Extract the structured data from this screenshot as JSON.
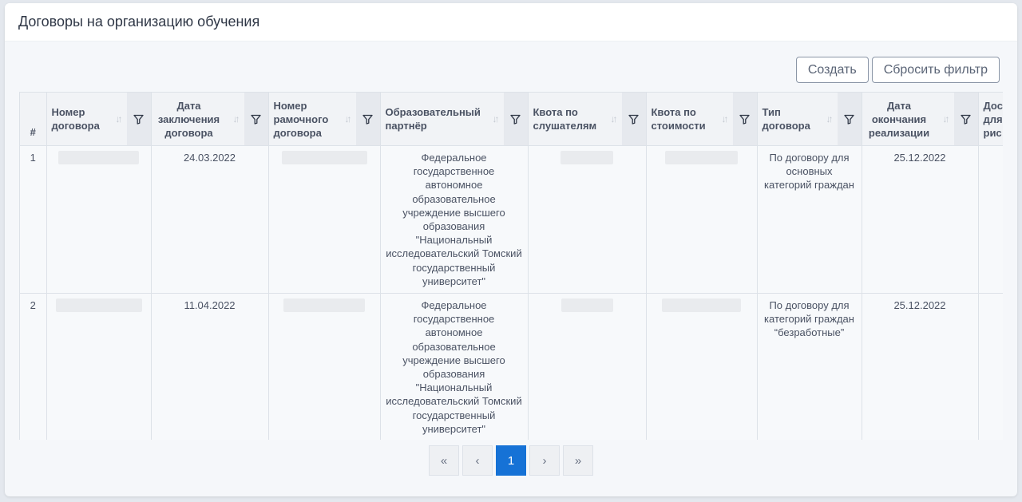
{
  "panel": {
    "title": "Договоры на организацию обучения"
  },
  "toolbar": {
    "create_label": "Создать",
    "reset_filter_label": "Сбросить фильтр"
  },
  "table": {
    "columns": [
      {
        "label": "#"
      },
      {
        "label": "Номер договора"
      },
      {
        "label": "Дата заключения договора"
      },
      {
        "label": "Номер рамочного договора"
      },
      {
        "label": "Образовательный партнёр"
      },
      {
        "label": "Квота по слушателям"
      },
      {
        "label": "Квота по стоимости"
      },
      {
        "label": "Тип договора"
      },
      {
        "label": "Дата окончания реализации"
      },
      {
        "label": "Дос для рис"
      }
    ],
    "rows": [
      {
        "index": "1",
        "date": "24.03.2022",
        "partner": "Федеральное государственное автономное образовательное учреждение высшего образования \"Национальный исследовательский Томский государственный университет\"",
        "type": "По договору для основных категорий граждан",
        "end_date": "25.12.2022"
      },
      {
        "index": "2",
        "date": "11.04.2022",
        "partner": "Федеральное государственное автономное образовательное учреждение высшего образования \"Национальный исследовательский Томский государственный университет\"",
        "type": "По договору для категорий граждан “безработные”",
        "end_date": "25.12.2022"
      }
    ]
  },
  "pagination": {
    "first": "«",
    "prev": "‹",
    "current": "1",
    "next": "›",
    "last": "»"
  },
  "icons": {
    "sort": "sort-icon",
    "filter": "filter-icon"
  },
  "colors": {
    "accent": "#1672d6"
  }
}
